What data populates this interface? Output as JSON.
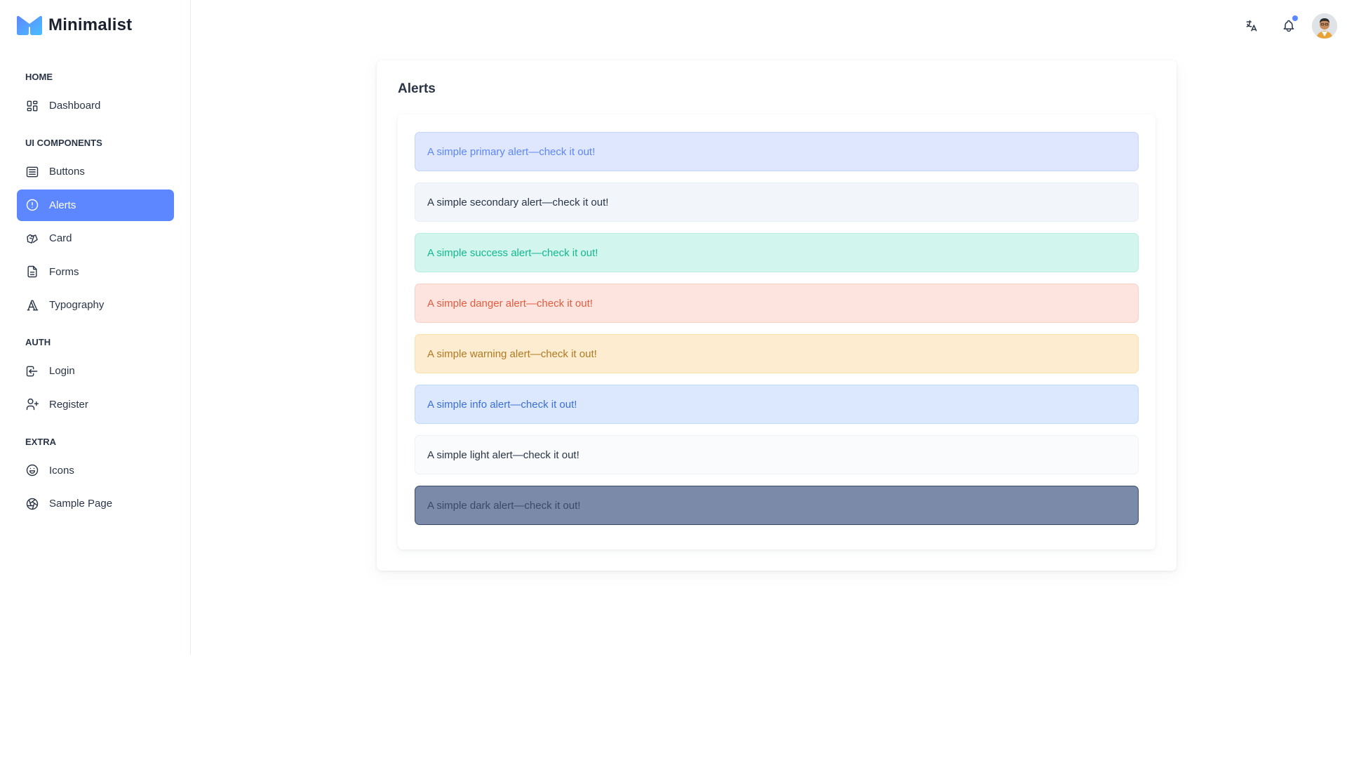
{
  "brand": {
    "name": "Minimalist"
  },
  "sidebar": {
    "sections": [
      {
        "title": "HOME",
        "items": [
          {
            "label": "Dashboard",
            "icon": "dashboard-icon"
          }
        ]
      },
      {
        "title": "UI COMPONENTS",
        "items": [
          {
            "label": "Buttons",
            "icon": "buttons-icon"
          },
          {
            "label": "Alerts",
            "icon": "alert-circle-icon",
            "active": true
          },
          {
            "label": "Card",
            "icon": "cards-icon"
          },
          {
            "label": "Forms",
            "icon": "file-description-icon"
          },
          {
            "label": "Typography",
            "icon": "typography-icon"
          }
        ]
      },
      {
        "title": "AUTH",
        "items": [
          {
            "label": "Login",
            "icon": "login-icon"
          },
          {
            "label": "Register",
            "icon": "user-plus-icon"
          }
        ]
      },
      {
        "title": "EXTRA",
        "items": [
          {
            "label": "Icons",
            "icon": "mood-happy-icon"
          },
          {
            "label": "Sample Page",
            "icon": "aperture-icon"
          }
        ]
      }
    ]
  },
  "header": {
    "icons": [
      "translate-icon",
      "bell-icon",
      "avatar"
    ],
    "notification_dot_color": "#5d87ff"
  },
  "main": {
    "title": "Alerts",
    "alerts": [
      {
        "variant": "primary",
        "text": "A simple primary alert—check it out!"
      },
      {
        "variant": "secondary",
        "text": "A simple secondary alert—check it out!"
      },
      {
        "variant": "success",
        "text": "A simple success alert—check it out!"
      },
      {
        "variant": "danger",
        "text": "A simple danger alert—check it out!"
      },
      {
        "variant": "warning",
        "text": "A simple warning alert—check it out!"
      },
      {
        "variant": "info",
        "text": "A simple info alert—check it out!"
      },
      {
        "variant": "light",
        "text": "A simple light alert—check it out!"
      },
      {
        "variant": "dark",
        "text": "A simple dark alert—check it out!"
      }
    ]
  },
  "colors": {
    "accent": "#5d87ff",
    "text": "#2a3547"
  }
}
